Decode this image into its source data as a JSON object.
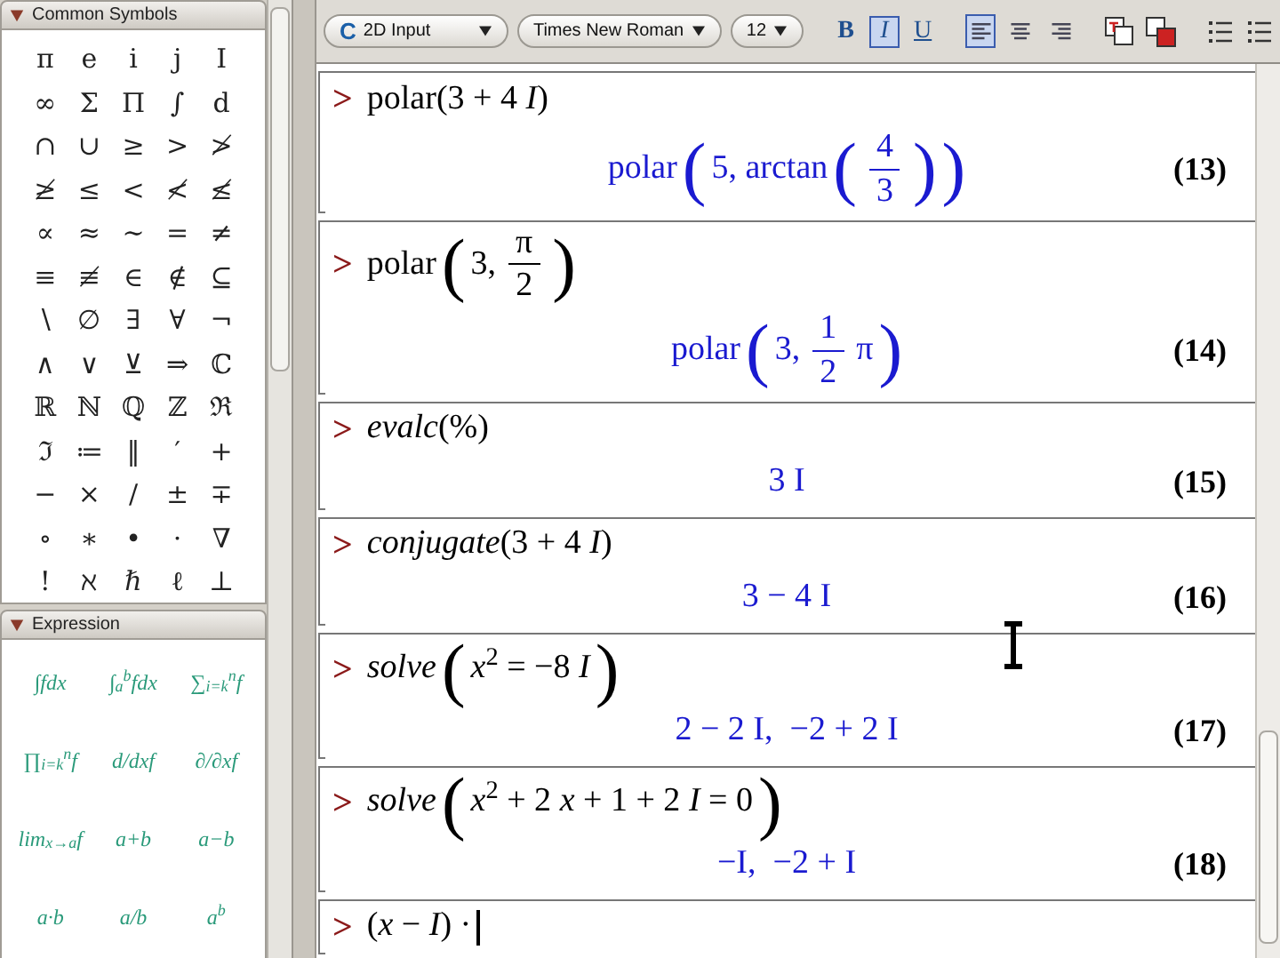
{
  "palettes": [
    {
      "title": "Common Symbols",
      "expanded": true,
      "kind": "symbols",
      "items": [
        "π",
        "e",
        "i",
        "j",
        "I",
        "∞",
        "Σ",
        "Π",
        "∫",
        "d",
        "∩",
        "∪",
        "≥",
        ">",
        "≯",
        "≱",
        "≤",
        "<",
        "≮",
        "≰",
        "∝",
        "≈",
        "∼",
        "=",
        "≠",
        "≡",
        "≢",
        "∈",
        "∉",
        "⊆",
        "∖",
        "∅",
        "∃",
        "∀",
        "¬",
        "∧",
        "∨",
        "⊻",
        "⇒",
        "ℂ",
        "ℝ",
        "ℕ",
        "ℚ",
        "ℤ",
        "ℜ",
        "ℑ",
        "≔",
        "‖",
        "′",
        "+",
        "−",
        "×",
        "/",
        "±",
        "∓",
        "∘",
        "∗",
        "•",
        "·",
        "∇",
        "!",
        "ℵ",
        "ℏ",
        "ℓ",
        "⊥"
      ]
    },
    {
      "title": "Expression",
      "expanded": true,
      "kind": "expressions",
      "items": [
        "∫fdx",
        "∫$_{a}$$^{b}$fdx",
        "∑$_{i=k}$$^{n}$f",
        "∏$_{i=k}$$^{n}$f",
        "d/dxf",
        "∂/∂xf",
        "lim$_{x→a}$f",
        "a+b",
        "a−b",
        "a·b",
        "a/b",
        "a$^{b}$"
      ]
    }
  ],
  "toolbar": {
    "mode": {
      "icon": "C",
      "label": "2D Input"
    },
    "font": "Times New Roman",
    "size": "12",
    "styles": [
      {
        "label": "B",
        "kind": "bold",
        "selected": false
      },
      {
        "label": "I",
        "kind": "italic",
        "selected": true
      },
      {
        "label": "U",
        "kind": "underline",
        "selected": false
      }
    ],
    "alignment": [
      {
        "kind": "left",
        "selected": true
      },
      {
        "kind": "center",
        "selected": false
      },
      {
        "kind": "right",
        "selected": false
      }
    ]
  },
  "worksheet": [
    {
      "prompt": ">",
      "input": [
        {
          "kind": "text",
          "text": "polar(3 + 4 *I*)"
        }
      ],
      "output": [
        {
          "kind": "text",
          "text": "polar"
        },
        {
          "kind": "paren",
          "text": "("
        },
        {
          "kind": "text",
          "text": "5, arctan"
        },
        {
          "kind": "paren",
          "text": "("
        },
        {
          "kind": "frac",
          "num": "4",
          "den": "3"
        },
        {
          "kind": "paren",
          "text": ")"
        },
        {
          "kind": "paren",
          "text": ")"
        }
      ],
      "label": "(13)"
    },
    {
      "prompt": ">",
      "input": [
        {
          "kind": "text",
          "text": "polar"
        },
        {
          "kind": "paren",
          "text": "("
        },
        {
          "kind": "text",
          "text": "3,"
        },
        {
          "kind": "frac",
          "num": "π",
          "den": "2"
        },
        {
          "kind": "paren",
          "text": ")"
        }
      ],
      "output": [
        {
          "kind": "text",
          "text": "polar"
        },
        {
          "kind": "paren",
          "text": "("
        },
        {
          "kind": "text",
          "text": "3,"
        },
        {
          "kind": "frac",
          "num": "1",
          "den": "2"
        },
        {
          "kind": "text",
          "text": "π"
        },
        {
          "kind": "paren",
          "text": ")"
        }
      ],
      "label": "(14)"
    },
    {
      "prompt": ">",
      "input": [
        {
          "kind": "text",
          "text": "*evalc*(%)"
        }
      ],
      "output": [
        {
          "kind": "text",
          "text": "3 I"
        }
      ],
      "label": "(15)"
    },
    {
      "prompt": ">",
      "input": [
        {
          "kind": "text",
          "text": "*conjugate*(3 + 4 *I*)"
        }
      ],
      "output": [
        {
          "kind": "text",
          "text": "3 − 4 I"
        }
      ],
      "label": "(16)"
    },
    {
      "prompt": ">",
      "input": [
        {
          "kind": "text",
          "text": "*solve*"
        },
        {
          "kind": "paren",
          "text": "("
        },
        {
          "kind": "text",
          "text": "*x*$^{2}$ = −8 *I*"
        },
        {
          "kind": "paren",
          "text": ")"
        }
      ],
      "output": [
        {
          "kind": "text",
          "text": "2 − 2 I,  −2 + 2 I"
        }
      ],
      "label": "(17)"
    },
    {
      "prompt": ">",
      "input": [
        {
          "kind": "text",
          "text": "*solve*"
        },
        {
          "kind": "paren",
          "text": "("
        },
        {
          "kind": "text",
          "text": "*x*$^{2}$ + 2 *x* + 1 + 2 *I* = 0"
        },
        {
          "kind": "paren",
          "text": ")"
        }
      ],
      "output": [
        {
          "kind": "text",
          "text": "−I,  −2 + I"
        }
      ],
      "label": "(18)"
    },
    {
      "prompt": ">",
      "input": [
        {
          "kind": "text",
          "text": "(*x* − *I*) ·"
        }
      ]
    }
  ]
}
